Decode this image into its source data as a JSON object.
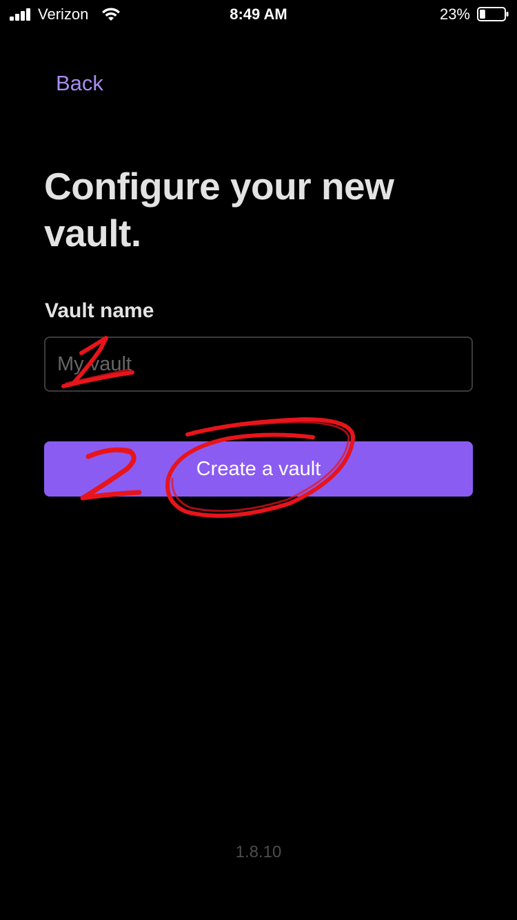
{
  "status_bar": {
    "carrier": "Verizon",
    "time": "8:49 AM",
    "battery_percent": "23%",
    "battery_level": 0.23,
    "signal_icon": "cellular-signal-icon",
    "wifi_icon": "wifi-icon",
    "battery_icon": "battery-icon"
  },
  "nav": {
    "back_label": "Back"
  },
  "page": {
    "title": "Configure your new vault."
  },
  "form": {
    "vault_name_label": "Vault name",
    "vault_name_placeholder": "My vault",
    "vault_name_value": "",
    "create_button_label": "Create a vault"
  },
  "footer": {
    "version": "1.8.10"
  },
  "annotations": {
    "marker_1": "1",
    "marker_2": "2",
    "color": "#e8141b"
  },
  "colors": {
    "background": "#000000",
    "accent": "#8b5cf2",
    "link": "#a98df0",
    "text": "#e3e3e3"
  }
}
